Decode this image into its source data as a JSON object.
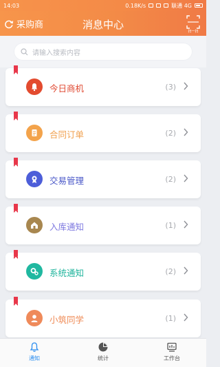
{
  "statusbar": {
    "time": "14:03",
    "speed": "0.18K/s",
    "carrier": "联通 4G"
  },
  "header": {
    "left_label": "采购商",
    "title": "消息中心"
  },
  "search": {
    "placeholder": "请输入搜索内容"
  },
  "messages": [
    {
      "label": "今日商机",
      "count": "(3)",
      "color": "#e34b2f",
      "text_color": "#e04a33",
      "icon": "bell-icon"
    },
    {
      "label": "合同订单",
      "count": "(2)",
      "color": "#f3a34b",
      "text_color": "#f0a04e",
      "icon": "document-icon"
    },
    {
      "label": "交易管理",
      "count": "(2)",
      "color": "#4d5ed9",
      "text_color": "#4a58c8",
      "icon": "award-icon"
    },
    {
      "label": "入库通知",
      "count": "(1)",
      "color": "#a8874f",
      "text_color": "#7f7ae0",
      "icon": "warehouse-icon"
    },
    {
      "label": "系统通知",
      "count": "(2)",
      "color": "#20b8a0",
      "text_color": "#1fb49c",
      "icon": "gear-icon"
    },
    {
      "label": "小筑同学",
      "count": "(1)",
      "color": "#ef8a5a",
      "text_color": "#ef8a55",
      "icon": "person-icon"
    }
  ],
  "tabs": [
    {
      "label": "通知",
      "active": true
    },
    {
      "label": "统计",
      "active": false
    },
    {
      "label": "工作台",
      "active": false
    }
  ],
  "colors": {
    "accent": "#f48b48",
    "tab_active": "#2b8df0",
    "tab_inactive": "#555555"
  }
}
